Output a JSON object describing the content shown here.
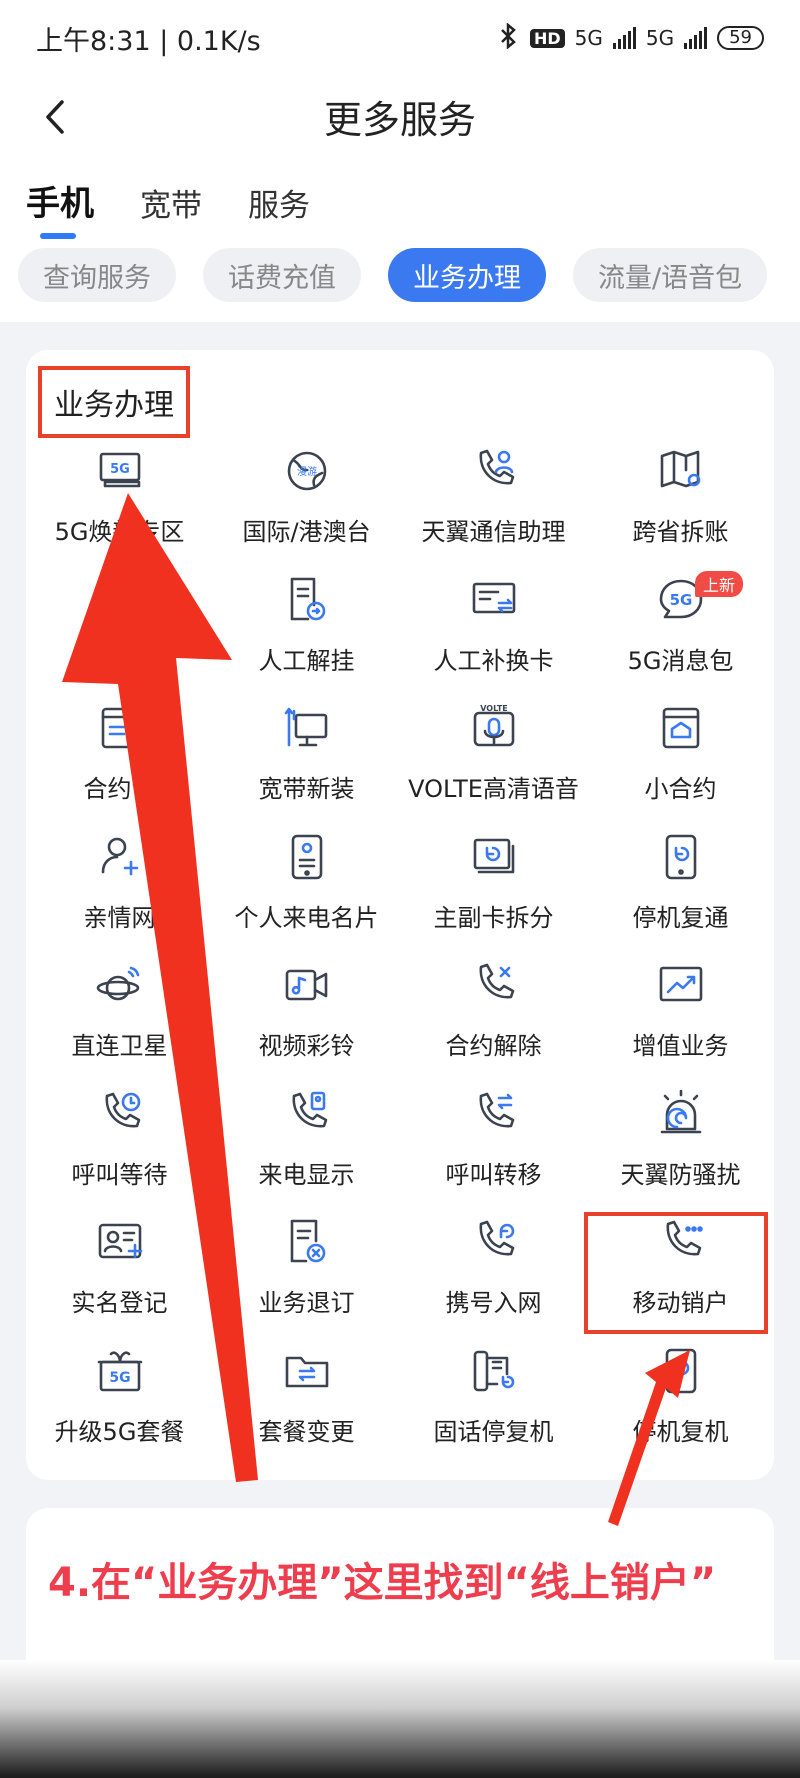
{
  "status": {
    "time": "上午8:31 | 0.1K/s",
    "hd_label": "HD",
    "net1": "5G",
    "net2": "5G",
    "battery": "59"
  },
  "header": {
    "title": "更多服务"
  },
  "top_tabs": [
    {
      "label": "手机",
      "active": true
    },
    {
      "label": "宽带",
      "active": false
    },
    {
      "label": "服务",
      "active": false
    }
  ],
  "chips": [
    {
      "label": "查询服务"
    },
    {
      "label": "话费充值"
    },
    {
      "label": "业务办理",
      "active": true
    },
    {
      "label": "流量/语音包"
    }
  ],
  "section": {
    "title": "业务办理"
  },
  "services": [
    {
      "label": "5G焕新专区",
      "icon": "5g-screen-icon"
    },
    {
      "label": "国际/港澳台",
      "icon": "roaming-globe-icon"
    },
    {
      "label": "天翼通信助理",
      "icon": "phone-assistant-icon"
    },
    {
      "label": "跨省拆账",
      "icon": "map-pin-icon"
    },
    {
      "label": "",
      "icon": ""
    },
    {
      "label": "人工解挂",
      "icon": "document-arrow-icon"
    },
    {
      "label": "人工补换卡",
      "icon": "card-swap-icon"
    },
    {
      "label": "5G消息包",
      "icon": "5g-message-icon",
      "badge": "上新"
    },
    {
      "label": "合约专",
      "icon": "contract-list-icon"
    },
    {
      "label": "宽带新装",
      "icon": "broadband-monitor-icon"
    },
    {
      "label": "VOLTE高清语音",
      "icon": "volte-mic-icon"
    },
    {
      "label": "小合约",
      "icon": "small-contract-icon"
    },
    {
      "label": "亲情网",
      "icon": "family-add-icon"
    },
    {
      "label": "个人来电名片",
      "icon": "caller-card-icon"
    },
    {
      "label": "主副卡拆分",
      "icon": "card-split-icon"
    },
    {
      "label": "停机复通",
      "icon": "phone-restore-icon"
    },
    {
      "label": "直连卫星",
      "icon": "satellite-planet-icon"
    },
    {
      "label": "视频彩铃",
      "icon": "video-ringtone-icon"
    },
    {
      "label": "合约解除",
      "icon": "phone-cancel-icon"
    },
    {
      "label": "增值业务",
      "icon": "trend-chart-icon"
    },
    {
      "label": "呼叫等待",
      "icon": "call-waiting-icon"
    },
    {
      "label": "来电显示",
      "icon": "caller-id-icon"
    },
    {
      "label": "呼叫转移",
      "icon": "call-forward-icon"
    },
    {
      "label": "天翼防骚扰",
      "icon": "alarm-shield-icon"
    },
    {
      "label": "实名登记",
      "icon": "id-card-add-icon"
    },
    {
      "label": "业务退订",
      "icon": "doc-cancel-icon"
    },
    {
      "label": "携号入网",
      "icon": "number-transfer-icon"
    },
    {
      "label": "移动销户",
      "icon": "phone-more-icon"
    },
    {
      "label": "升级5G套餐",
      "icon": "5g-gift-icon"
    },
    {
      "label": "套餐变更",
      "icon": "folder-swap-icon"
    },
    {
      "label": "固话停复机",
      "icon": "landline-restore-icon"
    },
    {
      "label": "停机复机",
      "icon": "mobile-restore-icon"
    }
  ],
  "instruction": "4.在“业务办理”这里找到“线上销户”",
  "colors": {
    "accent": "#3a79f0",
    "annotation_red": "#e8402a",
    "instruction_text": "#ee3d4d",
    "icon_dark": "#3b4250",
    "icon_blue": "#3a79f0"
  }
}
